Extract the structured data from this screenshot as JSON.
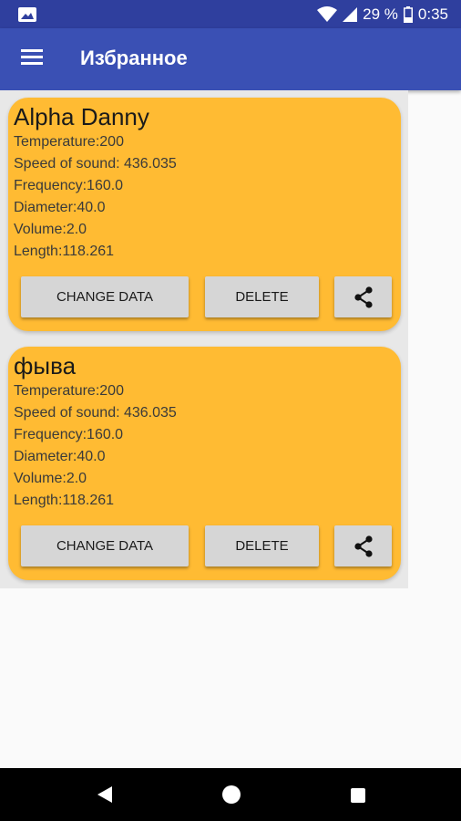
{
  "status_bar": {
    "battery_percent": "29 %",
    "time": "0:35"
  },
  "app_bar": {
    "title": "Избранное"
  },
  "favorites": [
    {
      "name": "Alpha Danny",
      "temperature": "Temperature:200",
      "speed_of_sound": "Speed of sound: 436.035",
      "frequency": "Frequency:160.0",
      "diameter": "Diameter:40.0",
      "volume": "Volume:2.0",
      "length": "Length:118.261",
      "change_label": "CHANGE DATA",
      "delete_label": "DELETE"
    },
    {
      "name": "фыва",
      "temperature": "Temperature:200",
      "speed_of_sound": "Speed of sound: 436.035",
      "frequency": "Frequency:160.0",
      "diameter": "Diameter:40.0",
      "volume": "Volume:2.0",
      "length": "Length:118.261",
      "change_label": "CHANGE DATA",
      "delete_label": "DELETE"
    }
  ],
  "colors": {
    "app_bar": "#3a50b4",
    "status_bar": "#2f3f9e",
    "card": "#ffbb33",
    "button": "#d6d6d6"
  }
}
